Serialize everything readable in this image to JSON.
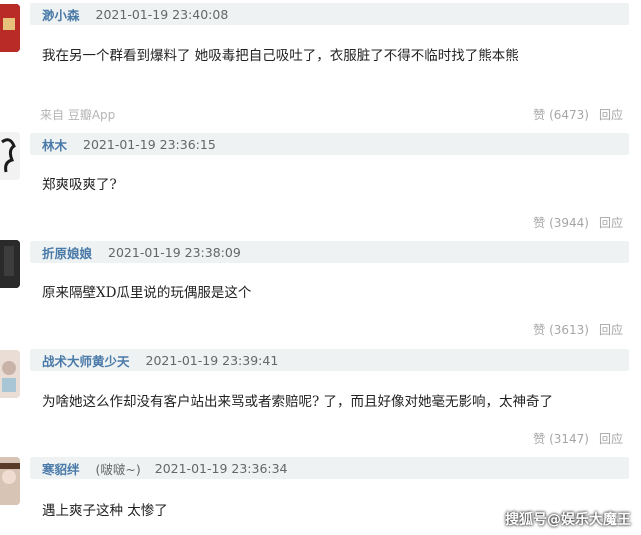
{
  "comments": [
    {
      "user": "渺小森",
      "user_extra": "",
      "time": "2021-01-19 23:40:08",
      "text": "我在另一个群看到爆料了 她吸毒把自己吸吐了，衣服脏了不得不临时找了熊本熊",
      "source": "来自 豆瓣App",
      "like": "赞 (6473)",
      "reply": "回应",
      "avatar_color": "#b92b27"
    },
    {
      "user": "林木",
      "user_extra": "",
      "time": "2021-01-19 23:36:15",
      "text": "郑爽吸爽了?",
      "source": "",
      "like": "赞 (3944)",
      "reply": "回应",
      "avatar_color": "#1b1b1b"
    },
    {
      "user": "折原娘娘",
      "user_extra": "",
      "time": "2021-01-19 23:38:09",
      "text": "原来隔壁XD瓜里说的玩偶服是这个",
      "source": "",
      "like": "赞 (3613)",
      "reply": "回应",
      "avatar_color": "#2a2a2a"
    },
    {
      "user": "战术大师黄少天",
      "user_extra": "",
      "time": "2021-01-19 23:39:41",
      "text": "为啥她这么作却没有客户站出来骂或者索赔呢? 了，而且好像对她毫无影响，太神奇了",
      "source": "",
      "like": "赞 (3147)",
      "reply": "回应",
      "avatar_color": "#c9b3a8"
    },
    {
      "user": "寒貂绊",
      "user_extra": "(啵啵~)",
      "time": "2021-01-19 23:36:34",
      "text": "遇上爽子这种 太惨了",
      "source": "",
      "like": "",
      "reply": "",
      "avatar_color": "#d8c4b4"
    }
  ],
  "watermark": "搜狐号@娱乐大魔王"
}
